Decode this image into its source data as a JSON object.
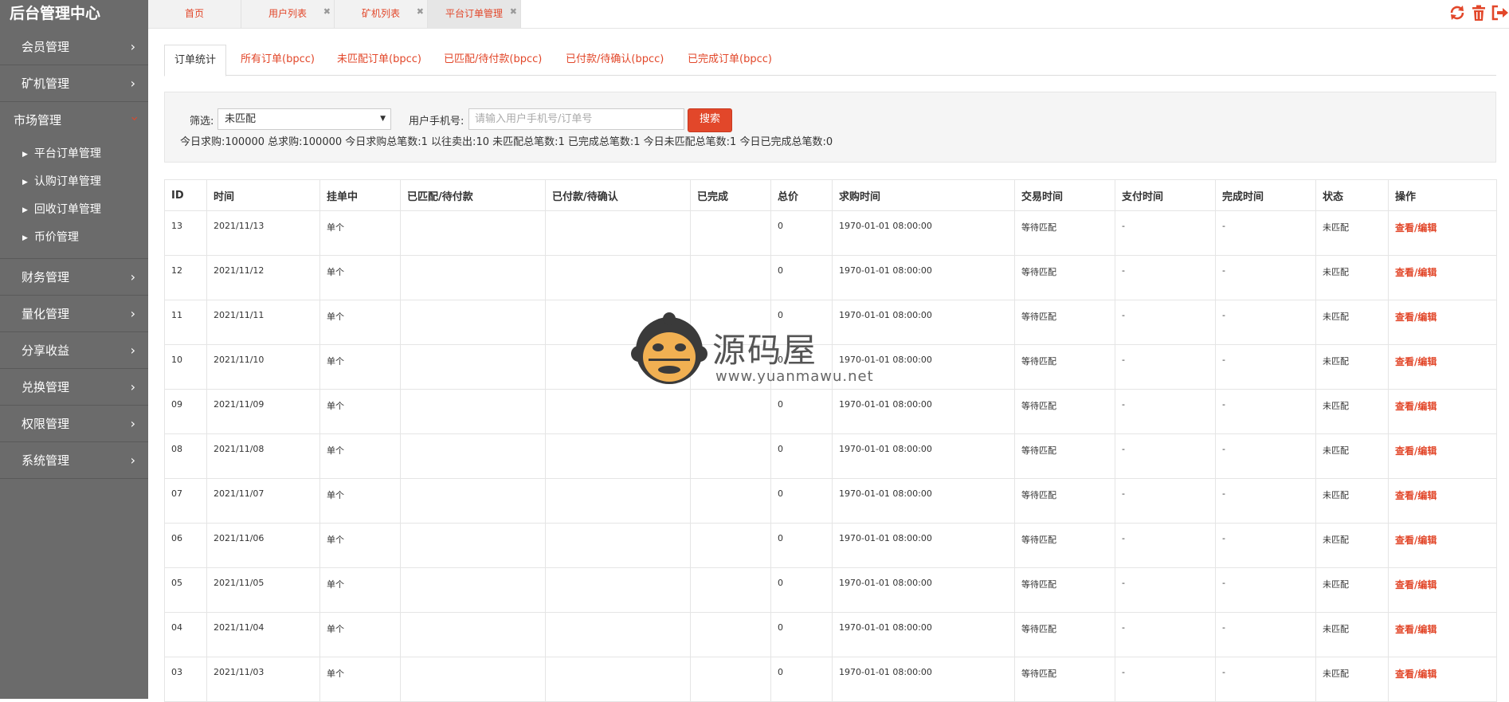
{
  "sidebar": {
    "brand": "后台管理中心",
    "items": [
      {
        "label": "会员管理"
      },
      {
        "label": "矿机管理"
      },
      {
        "label": "市场管理"
      },
      {
        "label": "财务管理"
      },
      {
        "label": "量化管理"
      },
      {
        "label": "分享收益"
      },
      {
        "label": "兑换管理"
      },
      {
        "label": "权限管理"
      },
      {
        "label": "系统管理"
      }
    ],
    "submenu": [
      {
        "label": "平台订单管理"
      },
      {
        "label": "认购订单管理"
      },
      {
        "label": "回收订单管理"
      },
      {
        "label": "币价管理"
      }
    ]
  },
  "top_tabs": [
    {
      "label": "首页",
      "closable": false
    },
    {
      "label": "用户列表",
      "closable": true
    },
    {
      "label": "矿机列表",
      "closable": true
    },
    {
      "label": "平台订单管理",
      "closable": true
    }
  ],
  "top_icons": [
    "refresh-icon",
    "trash-icon",
    "logout-icon"
  ],
  "content_tabs": [
    {
      "label": "订单统计"
    },
    {
      "label": "所有订单(bpcc)"
    },
    {
      "label": "未匹配订单(bpcc)"
    },
    {
      "label": "已匹配/待付款(bpcc)"
    },
    {
      "label": "已付款/待确认(bpcc)"
    },
    {
      "label": "已完成订单(bpcc)"
    }
  ],
  "filter": {
    "filter_label": "筛选:",
    "filter_value": "未匹配",
    "phone_label": "用户手机号:",
    "phone_placeholder": "请输入用户手机号/订单号",
    "phone_value": "",
    "search_button": "搜索",
    "stats": "今日求购:100000 总求购:100000 今日求购总笔数:1 以往卖出:10 未匹配总笔数:1 已完成总笔数:1 今日未匹配总笔数:1 今日已完成总笔数:0"
  },
  "table": {
    "columns": [
      "ID",
      "时间",
      "挂单中",
      "已匹配/待付款",
      "已付款/待确认",
      "已完成",
      "总价",
      "求购时间",
      "交易时间",
      "支付时间",
      "完成时间",
      "状态",
      "操作"
    ],
    "rows": [
      {
        "id": "13",
        "time": "2021/11/13",
        "pending": "单个",
        "matched": "",
        "paid": "",
        "done": "",
        "total": "0",
        "buy_time": "1970-01-01 08:00:00",
        "trade_time": "等待匹配",
        "pay_time": "-",
        "finish_time": "-",
        "status": "未匹配",
        "action": "查看/编辑"
      },
      {
        "id": "12",
        "time": "2021/11/12",
        "pending": "单个",
        "matched": "",
        "paid": "",
        "done": "",
        "total": "0",
        "buy_time": "1970-01-01 08:00:00",
        "trade_time": "等待匹配",
        "pay_time": "-",
        "finish_time": "-",
        "status": "未匹配",
        "action": "查看/编辑"
      },
      {
        "id": "11",
        "time": "2021/11/11",
        "pending": "单个",
        "matched": "",
        "paid": "",
        "done": "",
        "total": "0",
        "buy_time": "1970-01-01 08:00:00",
        "trade_time": "等待匹配",
        "pay_time": "-",
        "finish_time": "-",
        "status": "未匹配",
        "action": "查看/编辑"
      },
      {
        "id": "10",
        "time": "2021/11/10",
        "pending": "单个",
        "matched": "",
        "paid": "",
        "done": "",
        "total": "0",
        "buy_time": "1970-01-01 08:00:00",
        "trade_time": "等待匹配",
        "pay_time": "-",
        "finish_time": "-",
        "status": "未匹配",
        "action": "查看/编辑"
      },
      {
        "id": "09",
        "time": "2021/11/09",
        "pending": "单个",
        "matched": "",
        "paid": "",
        "done": "",
        "total": "0",
        "buy_time": "1970-01-01 08:00:00",
        "trade_time": "等待匹配",
        "pay_time": "-",
        "finish_time": "-",
        "status": "未匹配",
        "action": "查看/编辑"
      },
      {
        "id": "08",
        "time": "2021/11/08",
        "pending": "单个",
        "matched": "",
        "paid": "",
        "done": "",
        "total": "0",
        "buy_time": "1970-01-01 08:00:00",
        "trade_time": "等待匹配",
        "pay_time": "-",
        "finish_time": "-",
        "status": "未匹配",
        "action": "查看/编辑"
      },
      {
        "id": "07",
        "time": "2021/11/07",
        "pending": "单个",
        "matched": "",
        "paid": "",
        "done": "",
        "total": "0",
        "buy_time": "1970-01-01 08:00:00",
        "trade_time": "等待匹配",
        "pay_time": "-",
        "finish_time": "-",
        "status": "未匹配",
        "action": "查看/编辑"
      },
      {
        "id": "06",
        "time": "2021/11/06",
        "pending": "单个",
        "matched": "",
        "paid": "",
        "done": "",
        "total": "0",
        "buy_time": "1970-01-01 08:00:00",
        "trade_time": "等待匹配",
        "pay_time": "-",
        "finish_time": "-",
        "status": "未匹配",
        "action": "查看/编辑"
      },
      {
        "id": "05",
        "time": "2021/11/05",
        "pending": "单个",
        "matched": "",
        "paid": "",
        "done": "",
        "total": "0",
        "buy_time": "1970-01-01 08:00:00",
        "trade_time": "等待匹配",
        "pay_time": "-",
        "finish_time": "-",
        "status": "未匹配",
        "action": "查看/编辑"
      },
      {
        "id": "04",
        "time": "2021/11/04",
        "pending": "单个",
        "matched": "",
        "paid": "",
        "done": "",
        "total": "0",
        "buy_time": "1970-01-01 08:00:00",
        "trade_time": "等待匹配",
        "pay_time": "-",
        "finish_time": "-",
        "status": "未匹配",
        "action": "查看/编辑"
      },
      {
        "id": "03",
        "time": "2021/11/03",
        "pending": "单个",
        "matched": "",
        "paid": "",
        "done": "",
        "total": "0",
        "buy_time": "1970-01-01 08:00:00",
        "trade_time": "等待匹配",
        "pay_time": "-",
        "finish_time": "-",
        "status": "未匹配",
        "action": "查看/编辑"
      }
    ]
  },
  "watermark": {
    "cn": "源码屋",
    "url": "www.yuanmawu.net"
  },
  "colors": {
    "accent": "#e2472a",
    "sidebar_bg": "#6b6b6b",
    "panel_bg": "#f5f5f5"
  }
}
